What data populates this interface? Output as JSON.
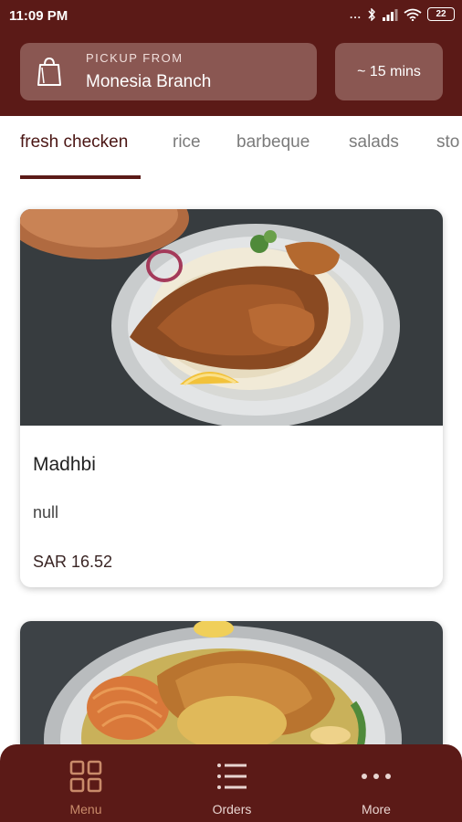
{
  "status_bar": {
    "time": "11:09 PM",
    "signal_dots": "...",
    "battery": "22"
  },
  "pickup": {
    "label": "PICKUP FROM",
    "branch": "Monesia Branch",
    "icon": "shopping-bag-icon"
  },
  "eta": {
    "label": "~ 15 mins"
  },
  "tabs": [
    {
      "label": "fresh checken",
      "active": true
    },
    {
      "label": "rice",
      "active": false
    },
    {
      "label": "barbeque",
      "active": false
    },
    {
      "label": "salads",
      "active": false
    },
    {
      "label": "sto",
      "active": false
    }
  ],
  "menu_items": [
    {
      "name": "Madhbi",
      "description": "null",
      "price": "SAR 16.52"
    }
  ],
  "bottom_nav": [
    {
      "label": "Menu",
      "icon": "grid-icon",
      "active": true
    },
    {
      "label": "Orders",
      "icon": "list-icon",
      "active": false
    },
    {
      "label": "More",
      "icon": "more-dots-icon",
      "active": false
    }
  ],
  "colors": {
    "brand": "#5b1a17",
    "card_accent": "#8a5752",
    "nav_active": "#c98b6a",
    "nav_inactive": "#e8d4d0"
  }
}
